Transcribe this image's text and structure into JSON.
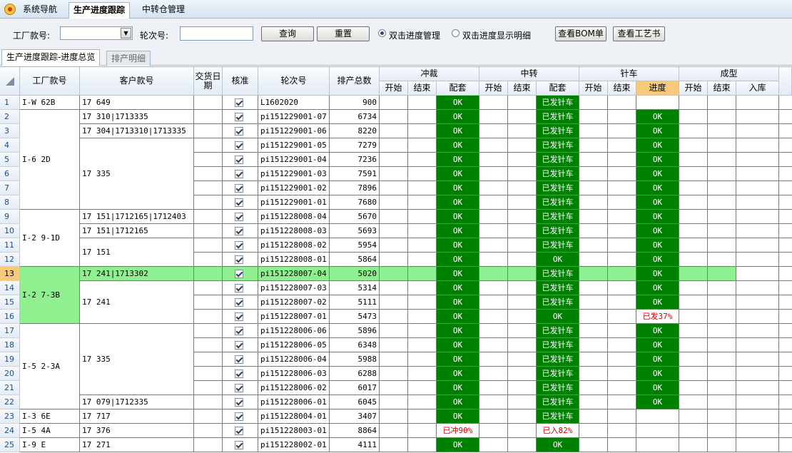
{
  "nav": {
    "tabs": [
      "系统导航",
      "生产进度跟踪",
      "中转仓管理"
    ],
    "active": 1
  },
  "filters": {
    "factory_label": "工厂款号:",
    "round_label": "轮次号:",
    "query_button": "查询",
    "reset_button": "重置",
    "radio1": "双击进度管理",
    "radio2": "双击进度显示明细",
    "bom_button": "查看BOM单",
    "process_button": "查看工艺书"
  },
  "subtabs": [
    "生产进度跟踪-进度总览",
    "排产明细"
  ],
  "headers": {
    "factory": "工厂款号",
    "customer": "客户款号",
    "delivery": "交货日期",
    "approve": "核准",
    "round": "轮次号",
    "total": "排产总数",
    "groups": [
      "冲裁",
      "中转",
      "针车",
      "成型"
    ],
    "sub": [
      "开始",
      "结束",
      "配套",
      "开始",
      "结束",
      "配套",
      "开始",
      "结束",
      "进度",
      "开始",
      "结束",
      "入库"
    ]
  },
  "factory_groups": [
    {
      "text": "I-W 62B",
      "rows": 1
    },
    {
      "text": "I-6 2D",
      "rows": 7
    },
    {
      "text": "I-2 9-1D",
      "rows": 4
    },
    {
      "text": "I-2 7-3B",
      "rows": 4
    },
    {
      "text": "I-5 2-3A",
      "rows": 6
    },
    {
      "text": "I-3 6E",
      "rows": 1
    },
    {
      "text": "I-5 4A",
      "rows": 1
    },
    {
      "text": "I-9 E",
      "rows": 1
    }
  ],
  "customer_groups": [
    {
      "text": "17 649",
      "rows": 1
    },
    {
      "text": "17 310|1713335",
      "rows": 1
    },
    {
      "text": "17 304|1713310|1713335",
      "rows": 1
    },
    {
      "text": "17 335",
      "rows": 5
    },
    {
      "text": "17 151|1712165|1712403",
      "rows": 1
    },
    {
      "text": "17 151|1712165",
      "rows": 1
    },
    {
      "text": "17 151",
      "rows": 2
    },
    {
      "text": "17 241|1713302",
      "rows": 1
    },
    {
      "text": "17 241",
      "rows": 3
    },
    {
      "text": "17 335",
      "rows": 5
    },
    {
      "text": "17 079|1712335",
      "rows": 1
    },
    {
      "text": "17 717",
      "rows": 1
    },
    {
      "text": "17 376",
      "rows": 1
    },
    {
      "text": "17 271",
      "rows": 1
    }
  ],
  "rows": [
    {
      "n": "1",
      "round": "L1602020",
      "total": "900",
      "cut": "OK",
      "trans": "已发针车",
      "prog": ""
    },
    {
      "n": "2",
      "round": "pi151229001-07",
      "total": "6734",
      "cut": "OK",
      "trans": "已发针车",
      "prog": "OK"
    },
    {
      "n": "3",
      "round": "pi151229001-06",
      "total": "8220",
      "cut": "OK",
      "trans": "已发针车",
      "prog": "OK"
    },
    {
      "n": "4",
      "round": "pi151229001-05",
      "total": "7279",
      "cut": "OK",
      "trans": "已发针车",
      "prog": "OK"
    },
    {
      "n": "5",
      "round": "pi151229001-04",
      "total": "7236",
      "cut": "OK",
      "trans": "已发针车",
      "prog": "OK"
    },
    {
      "n": "6",
      "round": "pi151229001-03",
      "total": "7591",
      "cut": "OK",
      "trans": "已发针车",
      "prog": "OK"
    },
    {
      "n": "7",
      "round": "pi151229001-02",
      "total": "7896",
      "cut": "OK",
      "trans": "已发针车",
      "prog": "OK"
    },
    {
      "n": "8",
      "round": "pi151229001-01",
      "total": "7680",
      "cut": "OK",
      "trans": "已发针车",
      "prog": "OK"
    },
    {
      "n": "9",
      "round": "pi151228008-04",
      "total": "5670",
      "cut": "OK",
      "trans": "已发针车",
      "prog": "OK"
    },
    {
      "n": "10",
      "round": "pi151228008-03",
      "total": "5693",
      "cut": "OK",
      "trans": "已发针车",
      "prog": "OK"
    },
    {
      "n": "11",
      "round": "pi151228008-02",
      "total": "5954",
      "cut": "OK",
      "trans": "已发针车",
      "prog": "OK"
    },
    {
      "n": "12",
      "round": "pi151228008-01",
      "total": "5864",
      "cut": "OK",
      "trans": "OK",
      "prog": "OK"
    },
    {
      "n": "13",
      "round": "pi151228007-04",
      "total": "5020",
      "cut": "OK",
      "trans": "已发针车",
      "prog": "OK"
    },
    {
      "n": "14",
      "round": "pi151228007-03",
      "total": "5314",
      "cut": "OK",
      "trans": "已发针车",
      "prog": "OK"
    },
    {
      "n": "15",
      "round": "pi151228007-02",
      "total": "5111",
      "cut": "OK",
      "trans": "已发针车",
      "prog": "OK"
    },
    {
      "n": "16",
      "round": "pi151228007-01",
      "total": "5473",
      "cut": "OK",
      "trans": "OK",
      "prog": "已发37%"
    },
    {
      "n": "17",
      "round": "pi151228006-06",
      "total": "5896",
      "cut": "OK",
      "trans": "已发针车",
      "prog": "OK"
    },
    {
      "n": "18",
      "round": "pi151228006-05",
      "total": "6348",
      "cut": "OK",
      "trans": "已发针车",
      "prog": "OK"
    },
    {
      "n": "19",
      "round": "pi151228006-04",
      "total": "5988",
      "cut": "OK",
      "trans": "已发针车",
      "prog": "OK"
    },
    {
      "n": "20",
      "round": "pi151228006-03",
      "total": "6288",
      "cut": "OK",
      "trans": "已发针车",
      "prog": "OK"
    },
    {
      "n": "21",
      "round": "pi151228006-02",
      "total": "6017",
      "cut": "OK",
      "trans": "已发针车",
      "prog": "OK"
    },
    {
      "n": "22",
      "round": "pi151228006-01",
      "total": "6045",
      "cut": "OK",
      "trans": "已发针车",
      "prog": "OK"
    },
    {
      "n": "23",
      "round": "pi151228004-01",
      "total": "3407",
      "cut": "OK",
      "trans": "已发针车",
      "prog": ""
    },
    {
      "n": "24",
      "round": "pi151228003-01",
      "total": "8864",
      "cut": "已冲90%",
      "trans": "已入82%",
      "prog": ""
    },
    {
      "n": "25",
      "round": "pi151228002-01",
      "total": "4111",
      "cut": "OK",
      "trans": "OK",
      "prog": ""
    }
  ],
  "selected_row": 13,
  "colors": {
    "ok_green": "#008000",
    "selection_green": "#90f090",
    "warn_red": "#d00000",
    "grid_blue": "#2f8fce"
  }
}
